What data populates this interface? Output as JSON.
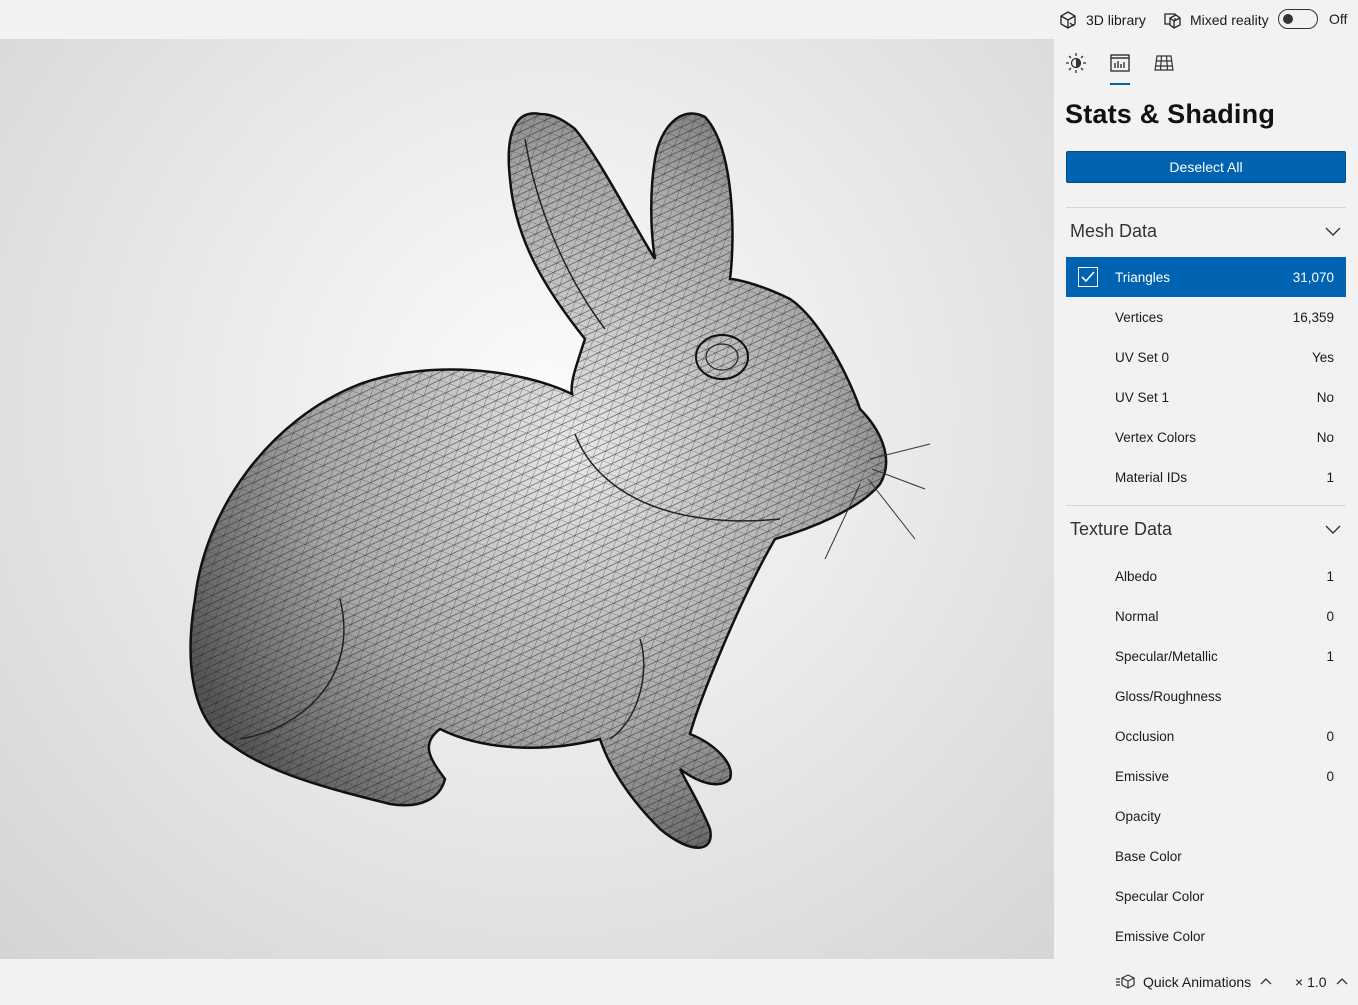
{
  "topbar": {
    "library_label": "3D library",
    "mixed_reality_label": "Mixed reality",
    "toggle_state": "Off"
  },
  "panel": {
    "title": "Stats & Shading",
    "deselect_label": "Deselect All",
    "tabs": [
      {
        "icon": "lighting-icon"
      },
      {
        "icon": "stats-icon",
        "active": true
      },
      {
        "icon": "grid-icon"
      }
    ],
    "mesh_section": {
      "title": "Mesh Data",
      "rows": [
        {
          "label": "Triangles",
          "value": "31,070",
          "selected": true
        },
        {
          "label": "Vertices",
          "value": "16,359"
        },
        {
          "label": "UV Set 0",
          "value": "Yes"
        },
        {
          "label": "UV Set 1",
          "value": "No"
        },
        {
          "label": "Vertex Colors",
          "value": "No"
        },
        {
          "label": "Material IDs",
          "value": "1"
        }
      ]
    },
    "texture_section": {
      "title": "Texture Data",
      "rows": [
        {
          "label": "Albedo",
          "value": "1"
        },
        {
          "label": "Normal",
          "value": "0"
        },
        {
          "label": "Specular/Metallic",
          "value": "1"
        },
        {
          "label": "Gloss/Roughness",
          "value": ""
        },
        {
          "label": "Occlusion",
          "value": "0"
        },
        {
          "label": "Emissive",
          "value": "0"
        },
        {
          "label": "Opacity",
          "value": ""
        },
        {
          "label": "Base Color",
          "value": ""
        },
        {
          "label": "Specular Color",
          "value": ""
        },
        {
          "label": "Emissive Color",
          "value": ""
        }
      ]
    }
  },
  "bottombar": {
    "quick_animations_label": "Quick Animations",
    "speed_label": "× 1.0"
  },
  "colors": {
    "accent": "#0063b1",
    "background": "#f2f2f2"
  }
}
